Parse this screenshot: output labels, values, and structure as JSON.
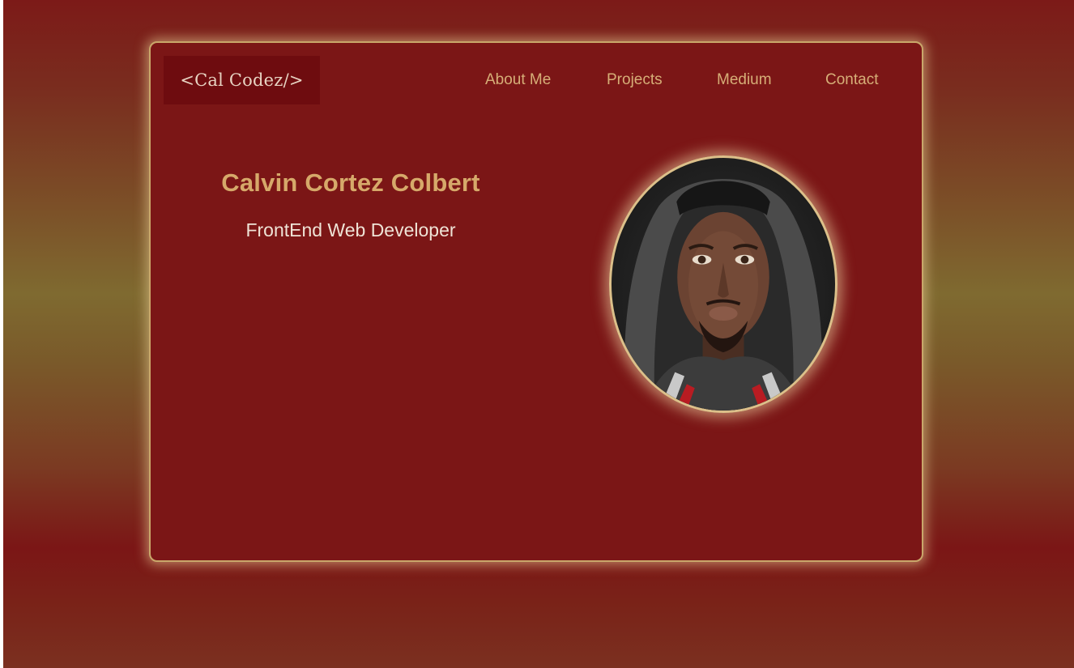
{
  "logo": {
    "text": "<Cal Codez/>"
  },
  "nav": {
    "items": [
      {
        "label": "About Me"
      },
      {
        "label": "Projects"
      },
      {
        "label": "Medium"
      },
      {
        "label": "Contact"
      }
    ]
  },
  "hero": {
    "name": "Calvin Cortez Colbert",
    "title": "FrontEnd Web Developer"
  },
  "colors": {
    "card_bg": "#7b1616",
    "accent_gold": "#d6a96a",
    "border_gold": "#c9a76a",
    "logo_bg": "#6e0c0f"
  }
}
